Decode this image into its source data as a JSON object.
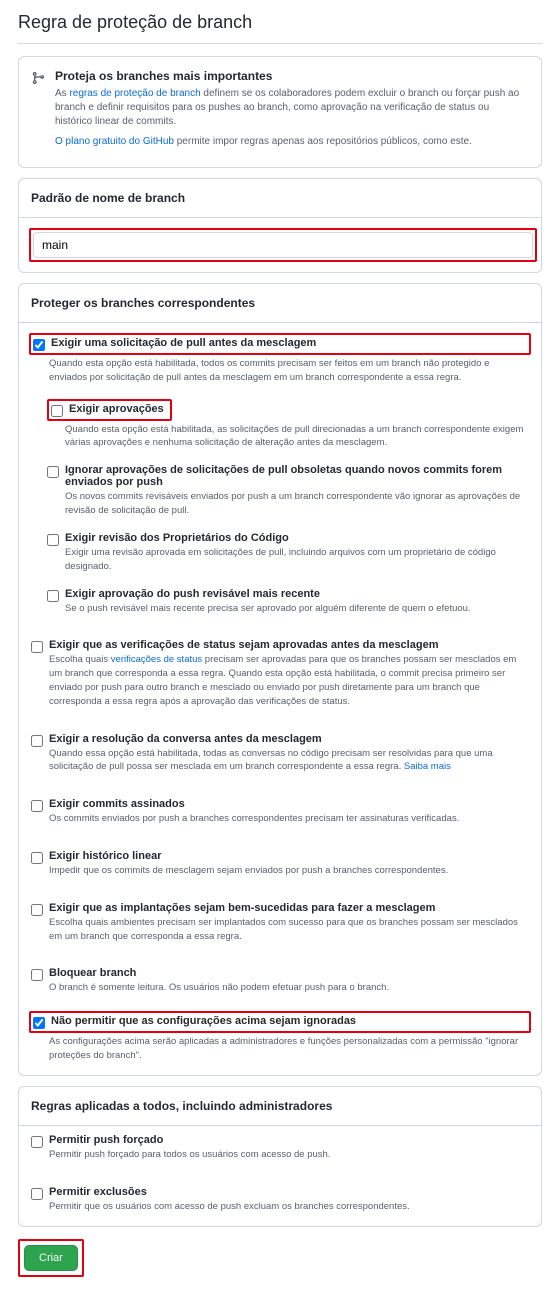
{
  "page_title": "Regra de proteção de branch",
  "info": {
    "heading": "Proteja os branches mais importantes",
    "text1_pre": "As ",
    "text1_link": "regras de proteção de branch",
    "text1_post": " definem se os colaboradores podem excluir o branch ou forçar push ao branch e definir requisitos para os pushes ao branch, como aprovação na verificação de status ou histórico linear de commits.",
    "text2_link": "O plano gratuito do GitHub",
    "text2_post": " permite impor regras apenas aos repositórios públicos, como este."
  },
  "pattern": {
    "header": "Padrão de nome de branch",
    "value": "main"
  },
  "protect": {
    "header": "Proteger os branches correspondentes",
    "opt_pr": {
      "label": "Exigir uma solicitação de pull antes da mesclagem",
      "desc": "Quando esta opção está habilitada, todos os commits precisam ser feitos em um branch não protegido e enviados por solicitação de pull antes da mesclagem em um branch correspondente a essa regra.",
      "checked": true
    },
    "opt_approvals": {
      "label": "Exigir aprovações",
      "desc": "Quando esta opção está habilitada, as solicitações de pull direcionadas a um branch correspondente exigem várias aprovações e nenhuma solicitação de alteração antes da mesclagem.",
      "checked": false
    },
    "opt_dismiss": {
      "label": "Ignorar aprovações de solicitações de pull obsoletas quando novos commits forem enviados por push",
      "desc": "Os novos commits revisáveis enviados por push a um branch correspondente vão ignorar as aprovações de revisão de solicitação de pull.",
      "checked": false
    },
    "opt_codeowners": {
      "label": "Exigir revisão dos Proprietários do Código",
      "desc": "Exigir uma revisão aprovada em solicitações de pull, incluindo arquivos com um proprietário de código designado.",
      "checked": false
    },
    "opt_lastpush": {
      "label": "Exigir aprovação do push revisável mais recente",
      "desc": "Se o push revisável mais recente precisa ser aprovado por alguém diferente de quem o efetuou.",
      "checked": false
    },
    "opt_status": {
      "label": "Exigir que as verificações de status sejam aprovadas antes da mesclagem",
      "desc_pre": "Escolha quais ",
      "desc_link": "verificações de status",
      "desc_post": " precisam ser aprovadas para que os branches possam ser mesclados em um branch que corresponda a essa regra. Quando esta opção está habilitada, o commit precisa primeiro ser enviado por push para outro branch e mesclado ou enviado por push diretamente para um branch que corresponda a essa regra após a aprovação das verificações de status.",
      "checked": false
    },
    "opt_conversation": {
      "label": "Exigir a resolução da conversa antes da mesclagem",
      "desc_pre": "Quando essa opção está habilitada, todas as conversas no código precisam ser resolvidas para que uma solicitação de pull possa ser mesclada em um branch correspondente a essa regra. ",
      "desc_link": "Saiba mais",
      "checked": false
    },
    "opt_signed": {
      "label": "Exigir commits assinados",
      "desc": "Os commits enviados por push a branches correspondentes precisam ter assinaturas verificadas.",
      "checked": false
    },
    "opt_linear": {
      "label": "Exigir histórico linear",
      "desc": "Impedir que os commits de mesclagem sejam enviados por push a branches correspondentes.",
      "checked": false
    },
    "opt_deploy": {
      "label": "Exigir que as implantações sejam bem-sucedidas para fazer a mesclagem",
      "desc": "Escolha quais ambientes precisam ser implantados com sucesso para que os branches possam ser mesclados em um branch que corresponda a essa regra.",
      "checked": false
    },
    "opt_lock": {
      "label": "Bloquear branch",
      "desc": "O branch é somente leitura. Os usuários não podem efetuar push para o branch.",
      "checked": false
    },
    "opt_nobypass": {
      "label": "Não permitir que as configurações acima sejam ignoradas",
      "desc": "As configurações acima serão aplicadas a administradores e funções personalizadas com a permissão \"ignorar proteções do branch\".",
      "checked": true
    }
  },
  "all_rules": {
    "header": "Regras aplicadas a todos, incluindo administradores",
    "opt_force": {
      "label": "Permitir push forçado",
      "desc": "Permitir push forçado para todos os usuários com acesso de push.",
      "checked": false
    },
    "opt_delete": {
      "label": "Permitir exclusões",
      "desc": "Permitir que os usuários com acesso de push excluam os branches correspondentes.",
      "checked": false
    }
  },
  "create_button": "Criar"
}
